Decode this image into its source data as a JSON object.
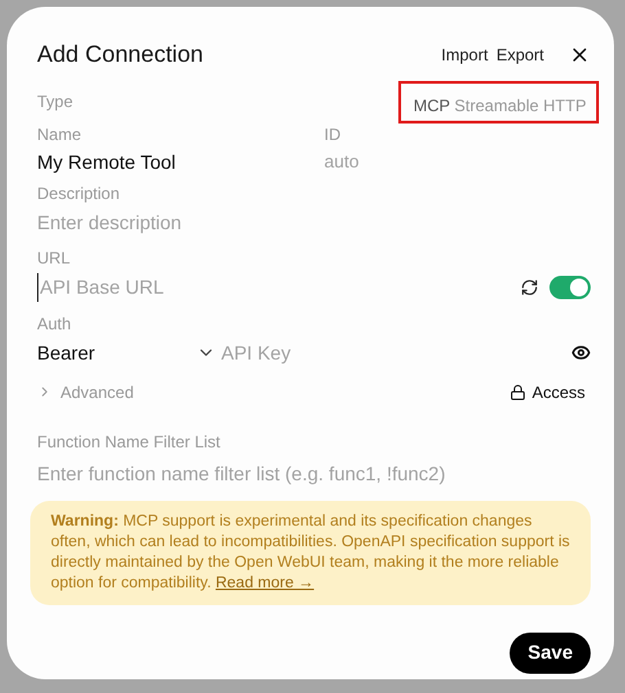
{
  "dialog": {
    "title": "Add Connection",
    "actions": [
      "Import",
      "Export"
    ]
  },
  "type": {
    "label": "Type",
    "value": "MCP",
    "detail": "Streamable HTTP"
  },
  "name": {
    "label": "Name",
    "value": "My Remote Tool"
  },
  "id": {
    "label": "ID",
    "placeholder": "auto"
  },
  "description": {
    "label": "Description",
    "placeholder": "Enter description"
  },
  "url": {
    "label": "URL",
    "placeholder": "API Base URL",
    "enabled": {
      "on": true
    }
  },
  "auth": {
    "label": "Auth",
    "method": "Bearer",
    "key_placeholder": "API Key"
  },
  "advanced": {
    "label": "Advanced",
    "expanded": false
  },
  "access": {
    "label": "Access"
  },
  "filter": {
    "label": "Function Name Filter List",
    "placeholder": "Enter function name filter list (e.g. func1, !func2)"
  },
  "warning": {
    "text": "**Warning:** MCP support is experimental and its specification changes often, which can lead to incompatibilities. OpenAPI specification support is directly maintained by the Open WebUI team, making it the more reliable option for compatibility.",
    "link": "Read more →"
  },
  "save": "Save"
}
